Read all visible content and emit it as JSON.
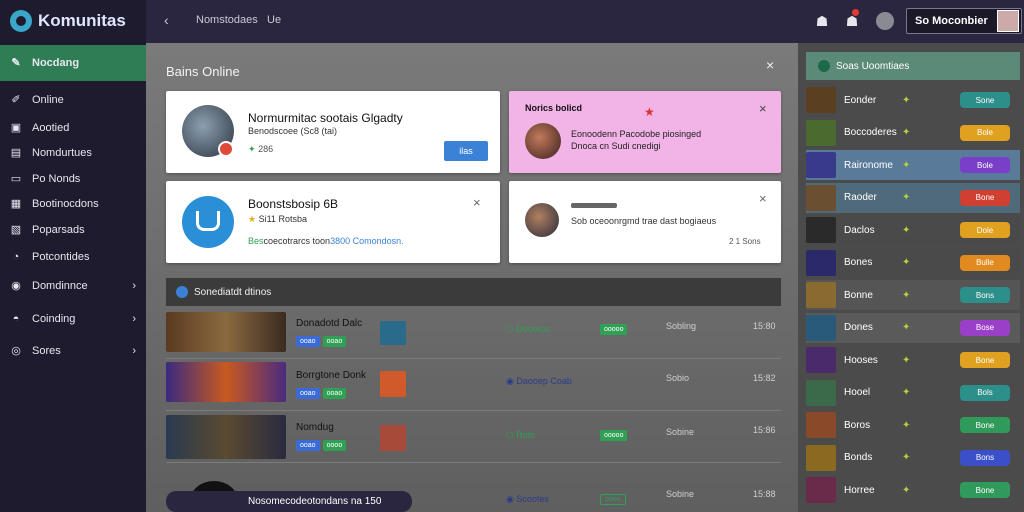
{
  "app": {
    "logo_text": "Komunitas"
  },
  "sidebar": {
    "items": [
      {
        "label": "Nocdang",
        "icon": "pencil-icon"
      },
      {
        "label": "Online",
        "icon": "edit-icon"
      },
      {
        "label": "Aootied",
        "icon": "grid-icon"
      },
      {
        "label": "Nomdurtues",
        "icon": "list-icon"
      },
      {
        "label": "Po Nonds",
        "icon": "box-icon"
      },
      {
        "label": "Bootinocdons",
        "icon": "layout-icon"
      },
      {
        "label": "Poparsads",
        "icon": "doc-icon"
      },
      {
        "label": "Potcontides",
        "icon": "circle-icon"
      },
      {
        "label": "Domdinnce",
        "icon": "gamepad-icon"
      },
      {
        "label": "Coinding",
        "icon": "controller-icon"
      },
      {
        "label": "Sores",
        "icon": "dot-circle-icon"
      }
    ]
  },
  "topbar": {
    "breadcrumb1": "Nomstodaes",
    "breadcrumb2": "Ue",
    "user_label": "So Moconbier"
  },
  "main": {
    "section_title": "Bains Online",
    "card1": {
      "title": "Normurmitac sootais Glgadty",
      "subtitle": "Benodscoee (Sc8 (tai)",
      "meta": "286",
      "button": "ilas"
    },
    "card2": {
      "title": "Norics bolicd",
      "line1": "Eonoodenn Pacodobe piosinged",
      "line2": "Dnoca cn Sudi cnedigi"
    },
    "card3": {
      "title": "Boonstsbosip 6B",
      "subtitle": "Si11 Rotsba",
      "desc_pre": "Bes",
      "desc": "coecotrarcs toon",
      "desc_link": "3800 Comondosn."
    },
    "card4": {
      "text": "Sob oceoonrgmd trae dast bogiaeus",
      "meta": "2 1 Sons"
    },
    "list_header": "Sonediatdt dtinos",
    "rows": [
      {
        "title": "Donadotd Dalc",
        "chip1": "ooao",
        "chip2": "ooao",
        "status": "Doooico",
        "badge": "ooooo",
        "col4": "Sobling",
        "col5": "15:80"
      },
      {
        "title": "Borrgtone Donk",
        "chip1": "ooao",
        "chip2": "ooao",
        "status": "Daooep Coab",
        "badge": "",
        "col4": "Sobio",
        "col5": "15:82"
      },
      {
        "title": "Nomdug",
        "chip1": "ooao",
        "chip2": "oooo",
        "status": "Rots",
        "badge": "ooooo",
        "col4": "Sobine",
        "col5": "15:86"
      },
      {
        "title": "Nosomecodeotondans na 150",
        "chip1": "",
        "chip2": "",
        "status": "Scootes",
        "badge": "oooo",
        "col4": "Sobine",
        "col5": "15:88"
      }
    ]
  },
  "right": {
    "header": "Soas Uoomtiaes",
    "items": [
      {
        "name": "Eonder",
        "badge": "Sone",
        "color": "#2d8f8a"
      },
      {
        "name": "Boccoderes",
        "badge": "Bole",
        "color": "#e0a020"
      },
      {
        "name": "Raironome",
        "badge": "Bole",
        "color": "#7a3fc8"
      },
      {
        "name": "Raoder",
        "badge": "Bone",
        "color": "#d04030"
      },
      {
        "name": "Daclos",
        "badge": "Dole",
        "color": "#e0a020"
      },
      {
        "name": "Bones",
        "badge": "Bulle",
        "color": "#e08a20"
      },
      {
        "name": "Bonne",
        "badge": "Bons",
        "color": "#2d8f8a"
      },
      {
        "name": "Dones",
        "badge": "Bose",
        "color": "#9a40c8"
      },
      {
        "name": "Hooses",
        "badge": "Bone",
        "color": "#e0a020"
      },
      {
        "name": "Hooel",
        "badge": "Bols",
        "color": "#2d8f8a"
      },
      {
        "name": "Boros",
        "badge": "Bone",
        "color": "#2f9a5a"
      },
      {
        "name": "Bonds",
        "badge": "Bons",
        "color": "#3b50c8"
      },
      {
        "name": "Horree",
        "badge": "Bone",
        "color": "#2f9a5a"
      }
    ]
  }
}
